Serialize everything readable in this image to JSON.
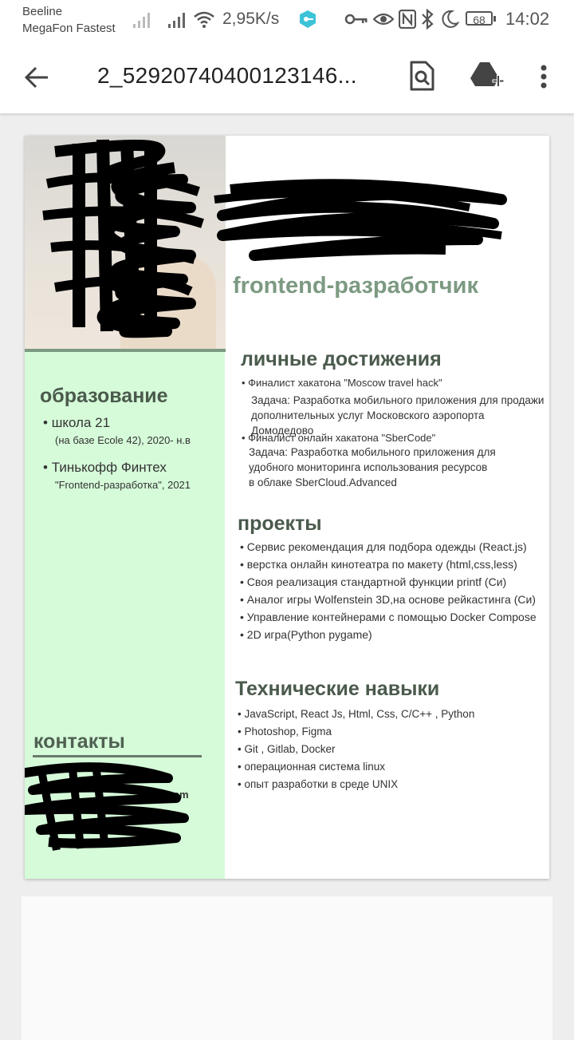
{
  "status_bar": {
    "carrier1": "Beeline",
    "carrier2": "MegaFon Fastest",
    "speed": "2,95K/s",
    "battery": "68",
    "time": "14:02"
  },
  "toolbar": {
    "title": "2_52920740400123146..."
  },
  "resume": {
    "role": "frontend-разработчик",
    "education_title": "образование",
    "education": [
      {
        "name": "школа 21",
        "detail": "(на базе Ecole 42), 2020- н.в"
      },
      {
        "name": "Тинькофф Финтех",
        "detail": "\"Frontend-разработка\", 2021"
      }
    ],
    "contacts_title": "контакты",
    "contacts_visible_fragment": "il.com",
    "achievements_title": "личные достижения",
    "achievements": [
      {
        "title": "Финалист хакатона \"Moscow travel hack\"",
        "lines": [
          "Задача: Разработка мобильного приложения для продажи",
          "дополнительных услуг Московского аэропорта Домодедово"
        ]
      },
      {
        "title": "Финалист онлайн хакатона \"SberCode\"",
        "lines": [
          "Задача: Разработка мобильного приложения для",
          "удобного мониторинга использования ресурсов",
          "в облаке SberCloud.Advanced"
        ]
      }
    ],
    "projects_title": "проекты",
    "projects": [
      "Сервис рекомендация для подбора одежды (React.js)",
      "верстка онлайн кинотеатра по макету (html,css,less)",
      "Своя реализация стандартной функции printf (Си)",
      "Аналог игры Wolfenstein 3D,на основе рейкастинга (Си)",
      "Управление контейнерами с помощью Docker Compose",
      "2D игра(Python pygame)"
    ],
    "skills_title": "Технические навыки",
    "skills": [
      "JavaScript, React Js, Html, Css, C/C++ , Python",
      "Photoshop, Figma",
      "Git , Gitlab, Docker",
      "операционная система linux",
      "опыт разработки в среде UNIX"
    ]
  },
  "colors": {
    "accent_green": "#7c9a82",
    "sidebar_bg": "#d6fbd9",
    "heading": "#4a5a4c"
  },
  "icons": [
    "back-arrow-icon",
    "search-document-icon",
    "drive-add-icon",
    "more-vert-icon",
    "key-icon",
    "eye-icon",
    "nfc-icon",
    "bluetooth-icon",
    "moon-icon",
    "wifi-icon",
    "signal-icon",
    "vpn-icon"
  ]
}
